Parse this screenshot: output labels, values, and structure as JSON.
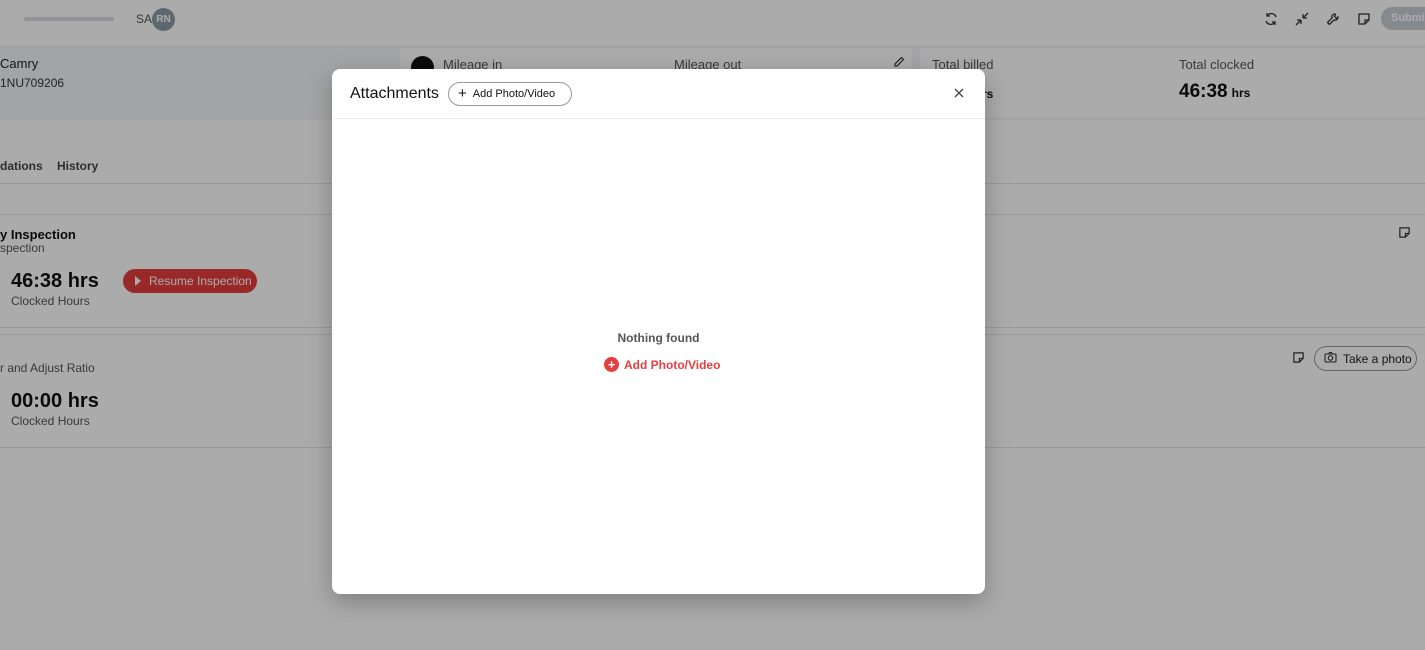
{
  "header": {
    "advisor_initials": "SA",
    "avatar_initials": "RN",
    "submit_label": "Submi",
    "icons": [
      "refresh-icon",
      "collapse-icon",
      "wrench-icon",
      "note-icon"
    ]
  },
  "vehicle": {
    "name": "Camry",
    "vin": "1NU709206"
  },
  "stats": {
    "mileage_in_label": "Mileage in",
    "mileage_out_label": "Mileage out",
    "total_billed_label": "Total billed",
    "total_billed_unit_partial": "rs",
    "total_clocked_label": "Total clocked",
    "total_clocked_value": "46:38",
    "total_clocked_unit": "hrs"
  },
  "tabs": {
    "recommendations": "dations",
    "history": "History"
  },
  "jobs": [
    {
      "title": "y Inspection",
      "subtitle": "spection",
      "hours": "46:38 hrs",
      "hours_label": "Clocked Hours",
      "action_label": "Resume Inspection"
    },
    {
      "title": "r and Adjust Ratio",
      "hours": "00:00 hrs",
      "hours_label": "Clocked Hours",
      "action_label": "Take a photo"
    }
  ],
  "modal": {
    "title": "Attachments",
    "add_button_label": "Add Photo/Video",
    "empty_text": "Nothing found",
    "empty_link_label": "Add Photo/Video"
  },
  "colors": {
    "accent": "#e53e3e",
    "overlay": "rgba(0,0,0,0.33)"
  }
}
